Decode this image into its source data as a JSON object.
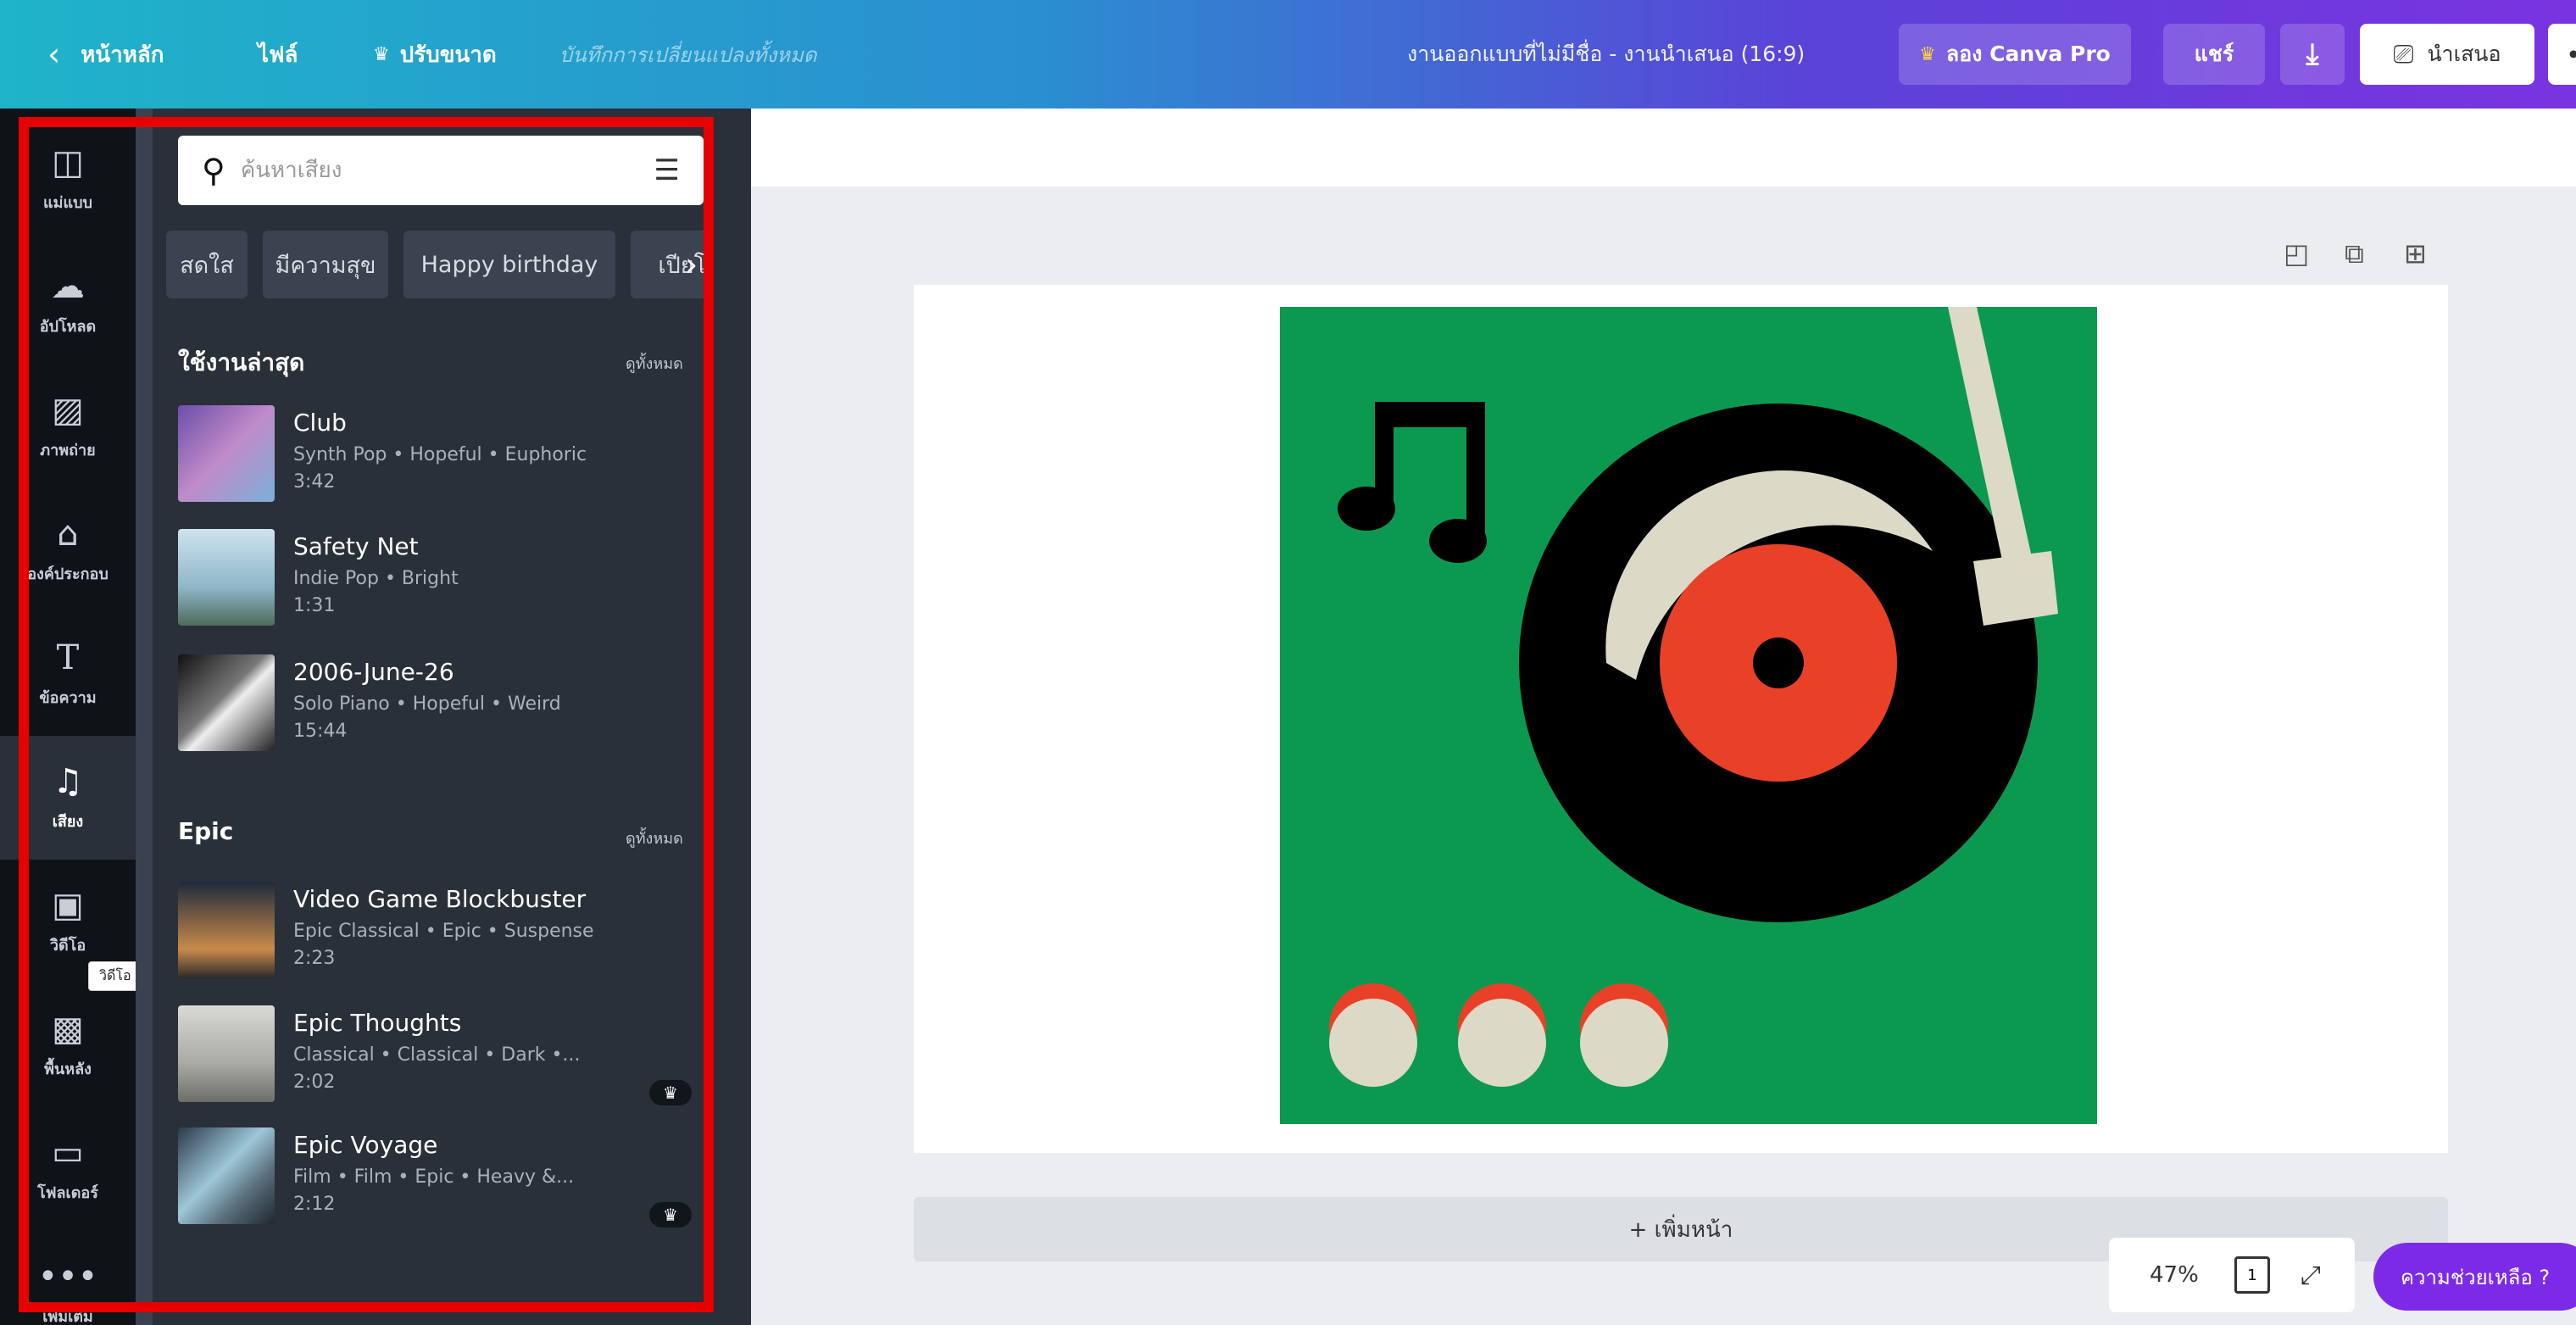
{
  "topbar": {
    "back_label": "หน้าหลัก",
    "file_label": "ไฟล์",
    "resize_label": "ปรับขนาด",
    "saved_status": "บันทึกการเปลี่ยนแปลงทั้งหมด",
    "doc_title": "งานออกแบบที่ไม่มีชื่อ - งานนำเสนอ (16:9)",
    "pro_label": "ลอง Canva Pro",
    "share_label": "แชร์",
    "present_label": "นำเสนอ"
  },
  "rail": {
    "items": [
      {
        "label": "แม่แบบ",
        "icon": "template-icon"
      },
      {
        "label": "อัปโหลด",
        "icon": "upload-icon"
      },
      {
        "label": "ภาพถ่าย",
        "icon": "photo-icon"
      },
      {
        "label": "องค์ประกอบ",
        "icon": "elements-icon"
      },
      {
        "label": "ข้อความ",
        "icon": "text-icon"
      },
      {
        "label": "เสียง",
        "icon": "music-icon"
      },
      {
        "label": "วิดีโอ",
        "icon": "video-icon"
      },
      {
        "label": "พื้นหลัง",
        "icon": "background-icon"
      },
      {
        "label": "โฟลเดอร์",
        "icon": "folder-icon"
      },
      {
        "label": "เพิ่มเติม",
        "icon": "more-icon"
      }
    ],
    "tooltip": "วิดีโอ"
  },
  "panel": {
    "search_placeholder": "ค้นหาเสียง",
    "chips": [
      "สดใส",
      "มีความสุข",
      "Happy birthday",
      "เปียโน"
    ],
    "sections": [
      {
        "title": "ใช้งานล่าสุด",
        "see_all": "ดูทั้งหมด",
        "tracks": [
          {
            "name": "Club",
            "meta": "Synth Pop • Hopeful • Euphoric",
            "duration": "3:42",
            "pro": false
          },
          {
            "name": "Safety Net",
            "meta": "Indie Pop • Bright",
            "duration": "1:31",
            "pro": false
          },
          {
            "name": "2006-June-26",
            "meta": "Solo Piano • Hopeful • Weird",
            "duration": "15:44",
            "pro": false
          }
        ]
      },
      {
        "title": "Epic",
        "see_all": "ดูทั้งหมด",
        "tracks": [
          {
            "name": "Video Game Blockbuster",
            "meta": "Epic Classical • Epic • Suspense",
            "duration": "2:23",
            "pro": false
          },
          {
            "name": "Epic Thoughts",
            "meta": "Classical • Classical • Dark •...",
            "duration": "2:02",
            "pro": true
          },
          {
            "name": "Epic Voyage",
            "meta": "Film • Film • Epic • Heavy &...",
            "duration": "2:12",
            "pro": true
          }
        ]
      }
    ]
  },
  "canvas": {
    "add_page_label": "+ เพิ่มหน้า",
    "zoom": "47%",
    "page_count": "1",
    "help_label": "ความช่วยเหลือ ?"
  },
  "colors": {
    "design_bg": "#0b9950",
    "record_label": "#e84127",
    "tonearm": "#dcd9c6",
    "highlight": "#e60000",
    "help": "#7d2ae8"
  }
}
